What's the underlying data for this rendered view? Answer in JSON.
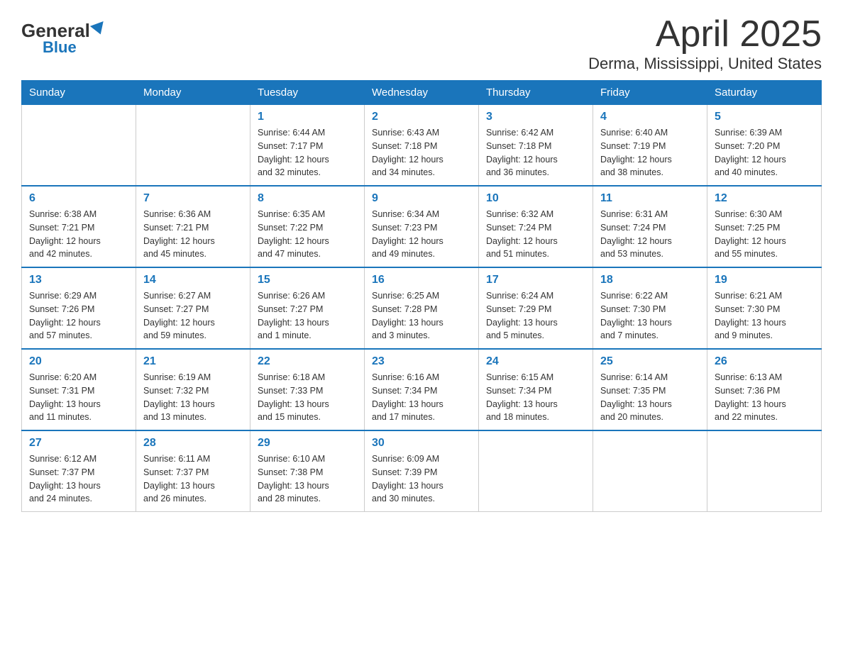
{
  "logo": {
    "general": "General",
    "blue": "Blue"
  },
  "title": "April 2025",
  "subtitle": "Derma, Mississippi, United States",
  "days_of_week": [
    "Sunday",
    "Monday",
    "Tuesday",
    "Wednesday",
    "Thursday",
    "Friday",
    "Saturday"
  ],
  "weeks": [
    [
      {
        "day": "",
        "info": ""
      },
      {
        "day": "",
        "info": ""
      },
      {
        "day": "1",
        "info": "Sunrise: 6:44 AM\nSunset: 7:17 PM\nDaylight: 12 hours\nand 32 minutes."
      },
      {
        "day": "2",
        "info": "Sunrise: 6:43 AM\nSunset: 7:18 PM\nDaylight: 12 hours\nand 34 minutes."
      },
      {
        "day": "3",
        "info": "Sunrise: 6:42 AM\nSunset: 7:18 PM\nDaylight: 12 hours\nand 36 minutes."
      },
      {
        "day": "4",
        "info": "Sunrise: 6:40 AM\nSunset: 7:19 PM\nDaylight: 12 hours\nand 38 minutes."
      },
      {
        "day": "5",
        "info": "Sunrise: 6:39 AM\nSunset: 7:20 PM\nDaylight: 12 hours\nand 40 minutes."
      }
    ],
    [
      {
        "day": "6",
        "info": "Sunrise: 6:38 AM\nSunset: 7:21 PM\nDaylight: 12 hours\nand 42 minutes."
      },
      {
        "day": "7",
        "info": "Sunrise: 6:36 AM\nSunset: 7:21 PM\nDaylight: 12 hours\nand 45 minutes."
      },
      {
        "day": "8",
        "info": "Sunrise: 6:35 AM\nSunset: 7:22 PM\nDaylight: 12 hours\nand 47 minutes."
      },
      {
        "day": "9",
        "info": "Sunrise: 6:34 AM\nSunset: 7:23 PM\nDaylight: 12 hours\nand 49 minutes."
      },
      {
        "day": "10",
        "info": "Sunrise: 6:32 AM\nSunset: 7:24 PM\nDaylight: 12 hours\nand 51 minutes."
      },
      {
        "day": "11",
        "info": "Sunrise: 6:31 AM\nSunset: 7:24 PM\nDaylight: 12 hours\nand 53 minutes."
      },
      {
        "day": "12",
        "info": "Sunrise: 6:30 AM\nSunset: 7:25 PM\nDaylight: 12 hours\nand 55 minutes."
      }
    ],
    [
      {
        "day": "13",
        "info": "Sunrise: 6:29 AM\nSunset: 7:26 PM\nDaylight: 12 hours\nand 57 minutes."
      },
      {
        "day": "14",
        "info": "Sunrise: 6:27 AM\nSunset: 7:27 PM\nDaylight: 12 hours\nand 59 minutes."
      },
      {
        "day": "15",
        "info": "Sunrise: 6:26 AM\nSunset: 7:27 PM\nDaylight: 13 hours\nand 1 minute."
      },
      {
        "day": "16",
        "info": "Sunrise: 6:25 AM\nSunset: 7:28 PM\nDaylight: 13 hours\nand 3 minutes."
      },
      {
        "day": "17",
        "info": "Sunrise: 6:24 AM\nSunset: 7:29 PM\nDaylight: 13 hours\nand 5 minutes."
      },
      {
        "day": "18",
        "info": "Sunrise: 6:22 AM\nSunset: 7:30 PM\nDaylight: 13 hours\nand 7 minutes."
      },
      {
        "day": "19",
        "info": "Sunrise: 6:21 AM\nSunset: 7:30 PM\nDaylight: 13 hours\nand 9 minutes."
      }
    ],
    [
      {
        "day": "20",
        "info": "Sunrise: 6:20 AM\nSunset: 7:31 PM\nDaylight: 13 hours\nand 11 minutes."
      },
      {
        "day": "21",
        "info": "Sunrise: 6:19 AM\nSunset: 7:32 PM\nDaylight: 13 hours\nand 13 minutes."
      },
      {
        "day": "22",
        "info": "Sunrise: 6:18 AM\nSunset: 7:33 PM\nDaylight: 13 hours\nand 15 minutes."
      },
      {
        "day": "23",
        "info": "Sunrise: 6:16 AM\nSunset: 7:34 PM\nDaylight: 13 hours\nand 17 minutes."
      },
      {
        "day": "24",
        "info": "Sunrise: 6:15 AM\nSunset: 7:34 PM\nDaylight: 13 hours\nand 18 minutes."
      },
      {
        "day": "25",
        "info": "Sunrise: 6:14 AM\nSunset: 7:35 PM\nDaylight: 13 hours\nand 20 minutes."
      },
      {
        "day": "26",
        "info": "Sunrise: 6:13 AM\nSunset: 7:36 PM\nDaylight: 13 hours\nand 22 minutes."
      }
    ],
    [
      {
        "day": "27",
        "info": "Sunrise: 6:12 AM\nSunset: 7:37 PM\nDaylight: 13 hours\nand 24 minutes."
      },
      {
        "day": "28",
        "info": "Sunrise: 6:11 AM\nSunset: 7:37 PM\nDaylight: 13 hours\nand 26 minutes."
      },
      {
        "day": "29",
        "info": "Sunrise: 6:10 AM\nSunset: 7:38 PM\nDaylight: 13 hours\nand 28 minutes."
      },
      {
        "day": "30",
        "info": "Sunrise: 6:09 AM\nSunset: 7:39 PM\nDaylight: 13 hours\nand 30 minutes."
      },
      {
        "day": "",
        "info": ""
      },
      {
        "day": "",
        "info": ""
      },
      {
        "day": "",
        "info": ""
      }
    ]
  ]
}
